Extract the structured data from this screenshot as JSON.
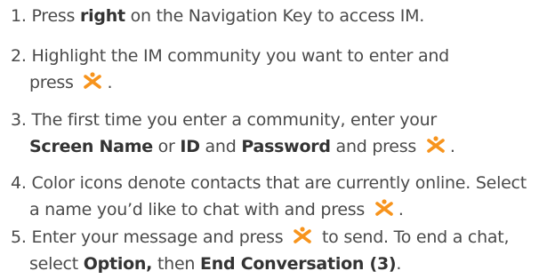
{
  "steps": [
    {
      "num": "1.",
      "line1": [
        {
          "t": "Press "
        },
        {
          "t": "right",
          "b": true
        },
        {
          "t": " on the Navigation Key to access IM."
        }
      ]
    },
    {
      "num": "2.",
      "line1": [
        {
          "t": "Highlight the IM community you want to enter and"
        }
      ],
      "line2": [
        {
          "t": "press "
        },
        {
          "icon": "ok-key-icon"
        },
        {
          "t": "."
        }
      ]
    },
    {
      "num": "3.",
      "line1": [
        {
          "t": "The first time you enter a community, enter your"
        }
      ],
      "line2": [
        {
          "t": "Screen Name",
          "b": true
        },
        {
          "t": " or "
        },
        {
          "t": "ID",
          "b": true
        },
        {
          "t": " and "
        },
        {
          "t": "Password",
          "b": true
        },
        {
          "t": " and press "
        },
        {
          "icon": "ok-key-icon"
        },
        {
          "t": "."
        }
      ]
    },
    {
      "num": "4.",
      "line1": [
        {
          "t": "Color icons denote contacts that are currently online. Select"
        }
      ],
      "line2": [
        {
          "t": "a name you’d like to chat with and press "
        },
        {
          "icon": "ok-key-icon"
        },
        {
          "t": "."
        }
      ]
    },
    {
      "num": "5.",
      "line1": [
        {
          "t": "Enter your message and press "
        },
        {
          "icon": "ok-key-icon"
        },
        {
          "t": " to send. To end a chat,"
        }
      ],
      "line2": [
        {
          "t": "select "
        },
        {
          "t": "Option,",
          "b": true
        },
        {
          "t": " then "
        },
        {
          "t": "End Conversation (3)",
          "b": true
        },
        {
          "t": "."
        }
      ]
    }
  ],
  "colors": {
    "text": "#4a4a4a",
    "bold_text": "#333333",
    "icon_accent": "#f7941d"
  }
}
